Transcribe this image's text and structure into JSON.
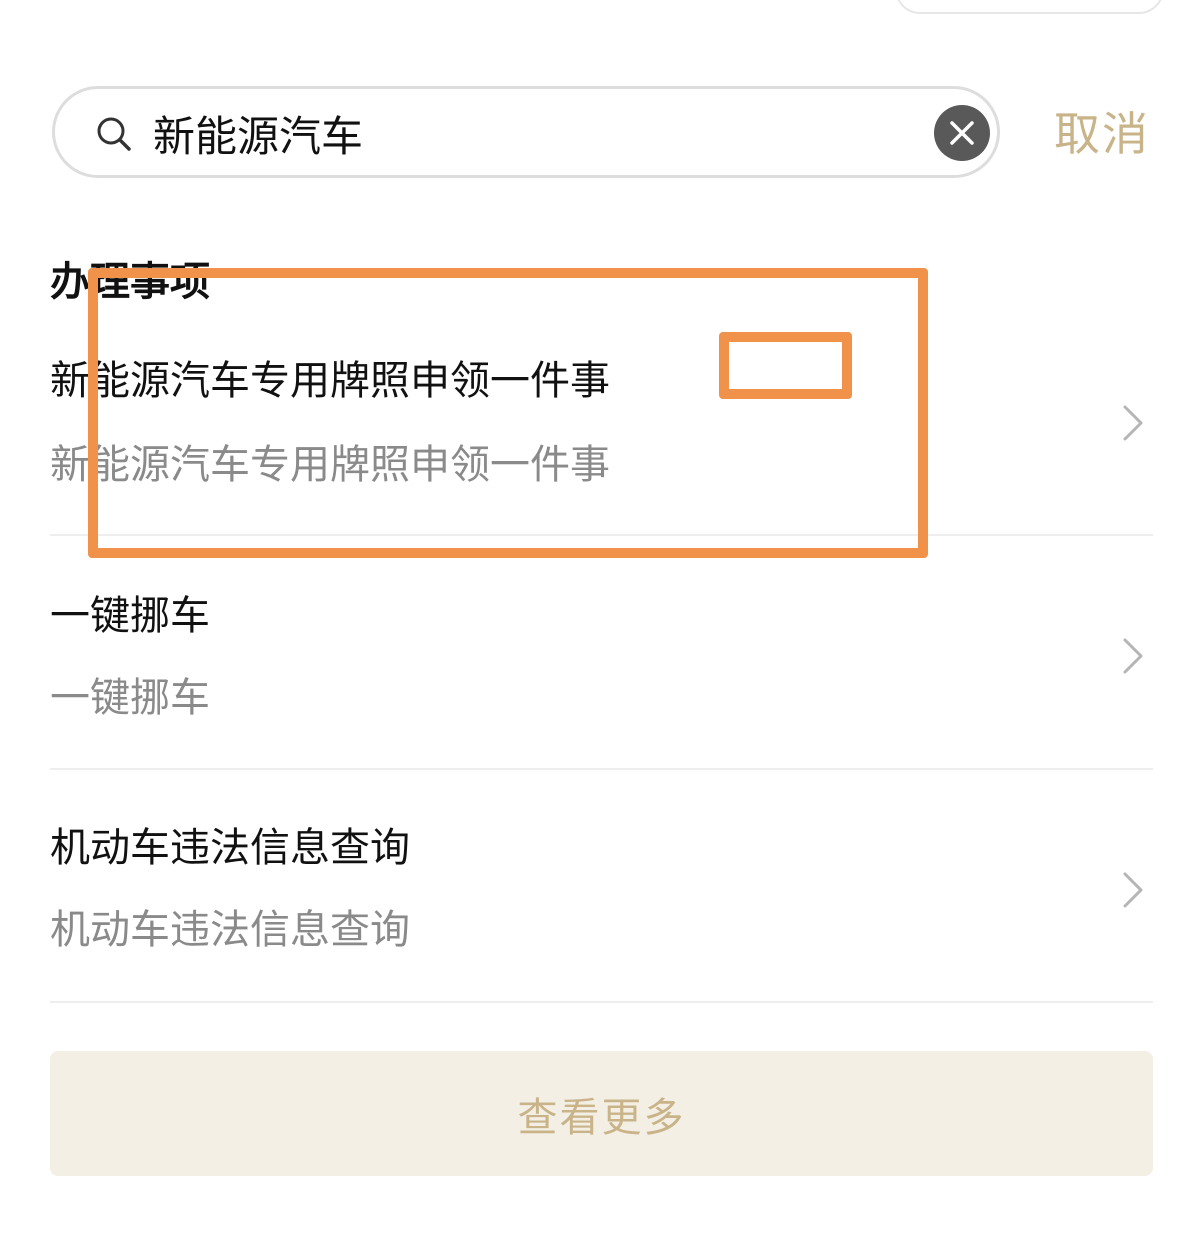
{
  "search": {
    "query": "新能源汽车",
    "cancel_label": "取消"
  },
  "section": {
    "title": "办理事项"
  },
  "items": [
    {
      "title": "新能源汽车专用牌照申领一件事",
      "subtitle": "新能源汽车专用牌照申领一件事"
    },
    {
      "title": "一键挪车",
      "subtitle": "一键挪车"
    },
    {
      "title": "机动车违法信息查询",
      "subtitle": "机动车违法信息查询"
    }
  ],
  "more_label": "查看更多",
  "colors": {
    "accent": "#c9b48a",
    "more_bg": "#f4efe4",
    "annotation": "#f0924a",
    "clear_button": "#595959"
  },
  "icons": {
    "search": "search-icon",
    "clear": "close-icon",
    "chevron": "chevron-right-icon"
  }
}
